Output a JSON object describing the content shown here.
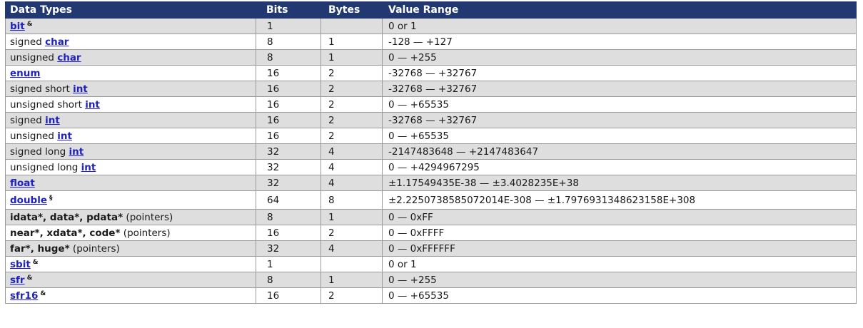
{
  "header": {
    "data_types": "Data Types",
    "bits": "Bits",
    "bytes": "Bytes",
    "value_range": "Value Range"
  },
  "rows": [
    {
      "link": "bit",
      "note": "&",
      "bits": "1",
      "bytes": "",
      "range": "0 or 1"
    },
    {
      "prefix": "signed ",
      "link": "char",
      "bits": "8",
      "bytes": "1",
      "range": "-128 — +127"
    },
    {
      "prefix": "unsigned ",
      "link": "char",
      "bits": "8",
      "bytes": "1",
      "range": "0 — +255"
    },
    {
      "link": "enum",
      "bits": "16",
      "bytes": "2",
      "range": "-32768 — +32767"
    },
    {
      "prefix": "signed short ",
      "link": "int",
      "bits": "16",
      "bytes": "2",
      "range": "-32768 — +32767"
    },
    {
      "prefix": "unsigned short ",
      "link": "int",
      "bits": "16",
      "bytes": "2",
      "range": "0 — +65535"
    },
    {
      "prefix": "signed ",
      "link": "int",
      "bits": "16",
      "bytes": "2",
      "range": "-32768 — +32767"
    },
    {
      "prefix": "unsigned ",
      "link": "int",
      "bits": "16",
      "bytes": "2",
      "range": "0 — +65535"
    },
    {
      "prefix": "signed long ",
      "link": "int",
      "bits": "32",
      "bytes": "4",
      "range": "-2147483648 — +2147483647"
    },
    {
      "prefix": "unsigned long ",
      "link": "int",
      "bits": "32",
      "bytes": "4",
      "range": "0 — +4294967295"
    },
    {
      "link": "float",
      "bits": "32",
      "bytes": "4",
      "range": "±1.17549435E-38 — ±3.4028235E+38"
    },
    {
      "link": "double",
      "note": "§",
      "bits": "64",
      "bytes": "8",
      "range": "±2.2250738585072014E-308 — ±1.7976931348623158E+308"
    },
    {
      "bold": "idata*, data*, pdata*",
      "suffix": " (pointers)",
      "bits": "8",
      "bytes": "1",
      "range": "0 — 0xFF"
    },
    {
      "bold": "near*, xdata*, code*",
      "suffix": " (pointers)",
      "bits": "16",
      "bytes": "2",
      "range": "0 — 0xFFFF"
    },
    {
      "bold": "far*, huge*",
      "suffix": " (pointers)",
      "bits": "32",
      "bytes": "4",
      "range": "0 — 0xFFFFFF"
    },
    {
      "link": "sbit",
      "note": "&",
      "bits": "1",
      "bytes": "",
      "range": "0 or 1"
    },
    {
      "link": "sfr",
      "note": "&",
      "bits": "8",
      "bytes": "1",
      "range": "0 — +255"
    },
    {
      "link": "sfr16",
      "note": "&",
      "bits": "16",
      "bytes": "2",
      "range": "0 — +65535"
    }
  ]
}
